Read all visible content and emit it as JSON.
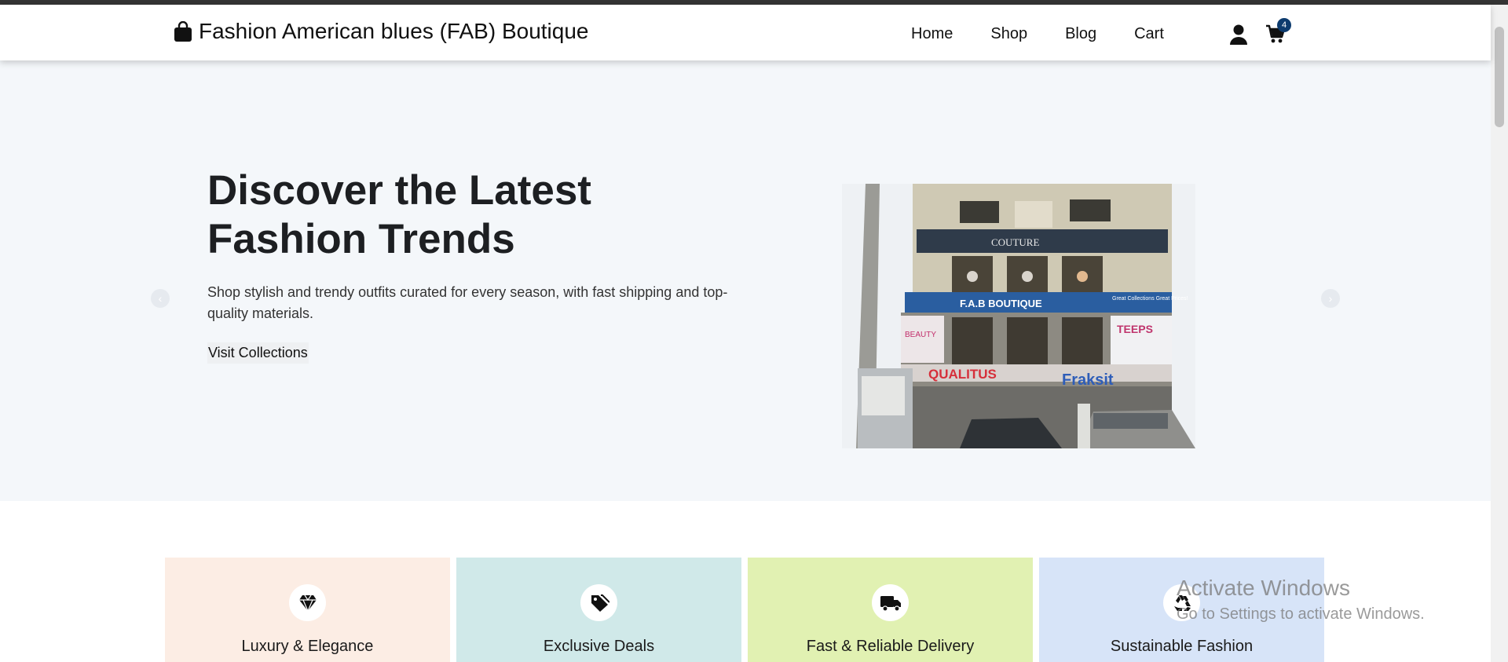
{
  "brand": {
    "name": "Fashion American blues (FAB) Boutique",
    "icon": "shopping-bag-icon"
  },
  "nav": {
    "items": [
      {
        "label": "Home"
      },
      {
        "label": "Shop"
      },
      {
        "label": "Blog"
      },
      {
        "label": "Cart"
      }
    ],
    "icons": [
      "user-icon",
      "cart-icon"
    ],
    "cart_count": "4"
  },
  "hero": {
    "title": "Discover the Latest Fashion Trends",
    "subtitle": "Shop stylish and trendy outfits curated for every season, with fast shipping and top-quality materials.",
    "button": "Visit Collections",
    "storefront": {
      "sign_couture": "COUTURE",
      "sign_fab": "F.A.B BOUTIQUE",
      "sign_great": "Great Collections Great Prices!",
      "sign_beauty": "BEAUTY",
      "sign_teeps": "TEEPS",
      "sign_qualitus": "QUALITUS",
      "sign_fraksit": "Fraksit"
    },
    "colors": {
      "background": "#f4f7fa"
    }
  },
  "features": [
    {
      "label": "Luxury & Elegance",
      "icon": "gem-icon",
      "color": "#fcede4"
    },
    {
      "label": "Exclusive Deals",
      "icon": "tags-icon",
      "color": "#d0e9e9"
    },
    {
      "label": "Fast & Reliable Delivery",
      "icon": "truck-icon",
      "color": "#e1f1b2"
    },
    {
      "label": "Sustainable Fashion",
      "icon": "recycle-icon",
      "color": "#d7e4f8"
    }
  ],
  "watermark": {
    "line1": "Activate Windows",
    "line2": "Go to Settings to activate Windows."
  }
}
